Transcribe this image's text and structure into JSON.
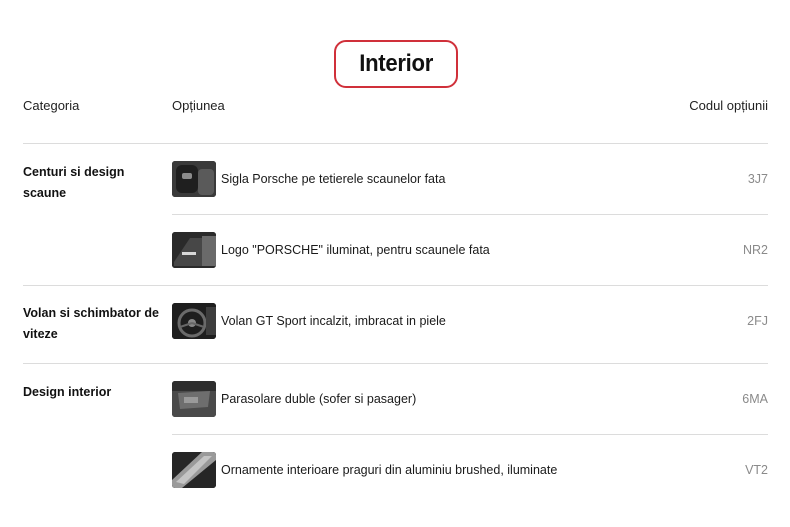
{
  "section_title": "Interior",
  "table": {
    "headers": {
      "category": "Categoria",
      "option": "Opțiunea",
      "code": "Codul opțiunii"
    },
    "groups": [
      {
        "category": "Centuri si design scaune",
        "options": [
          {
            "label": "Sigla Porsche pe tetierele scaunelor fata",
            "code": "3J7",
            "thumb": "headrest-logo-icon"
          },
          {
            "label": "Logo \"PORSCHE\" iluminat, pentru scaunele fata",
            "code": "NR2",
            "thumb": "illuminated-logo-icon"
          }
        ]
      },
      {
        "category": "Volan si schimbator de viteze",
        "options": [
          {
            "label": "Volan GT Sport incalzit, imbracat in piele",
            "code": "2FJ",
            "thumb": "steering-wheel-icon"
          }
        ]
      },
      {
        "category": "Design interior",
        "options": [
          {
            "label": "Parasolare duble (sofer si pasager)",
            "code": "6MA",
            "thumb": "sun-visor-icon"
          },
          {
            "label": "Ornamente interioare praguri din aluminiu brushed, iluminate",
            "code": "VT2",
            "thumb": "door-sill-icon"
          }
        ]
      }
    ]
  },
  "colors": {
    "title_outline": "#d0303a",
    "divider": "#dcdcdc",
    "code_text": "#8a8a8a"
  }
}
